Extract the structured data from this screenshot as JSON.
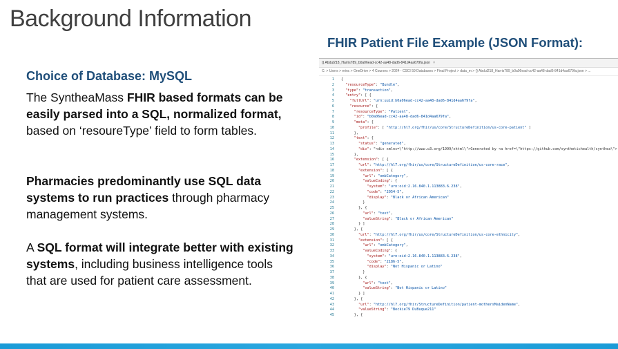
{
  "slide": {
    "title": "Background Information"
  },
  "left": {
    "subheading": "Choice of Database:  MySQL",
    "p1": {
      "a": "The SyntheaMass ",
      "b": "FHIR based formats can be easily parsed into a SQL, normalized format,",
      "c": " based on ‘resoureType’ field to form tables."
    },
    "p2": {
      "a": "Pharmacies predominantly use SQL data systems to run practices",
      "b": " through pharmacy management systems."
    },
    "p3": {
      "a": "A ",
      "b": "SQL format will integrate better with existing systems",
      "c": ", including business intelligence tools that are used for patient care assessment."
    }
  },
  "right": {
    "caption": "FHIR Patient File Example (JSON Format):",
    "tab_label": "{} Abdul218_Harris789_b0a06ead-cc42-aa48-dad6-841d4aa679fa.json",
    "tab_close": "×",
    "breadcrumb": "C: > Users > erinc > OneDrive > 4 Courses > 2024 - CSCI 59 Databases > Final Project > data_m > {} Abdul218_Harris789_b0a06ead-cc42-aa48-dad6-841d4aa679fa.json > ...",
    "code": [
      {
        "n": "1",
        "t": "{"
      },
      {
        "n": "2",
        "t": "  \"resourceType\": \"Bundle\","
      },
      {
        "n": "3",
        "t": "  \"type\": \"transaction\","
      },
      {
        "n": "4",
        "t": "  \"entry\": [ {"
      },
      {
        "n": "5",
        "t": "    \"fullUrl\": \"urn:uuid:b0a06ead-cc42-aa48-dad6-841d4aa679fa\","
      },
      {
        "n": "6",
        "t": "    \"resource\": {"
      },
      {
        "n": "7",
        "t": "      \"resourceType\": \"Patient\","
      },
      {
        "n": "8",
        "t": "      \"id\": \"b0a06ead-cc42-aa48-dad6-841d4aa679fa\","
      },
      {
        "n": "9",
        "t": "      \"meta\": {"
      },
      {
        "n": "10",
        "t": "        \"profile\": [ \"http://hl7.org/fhir/us/core/StructureDefinition/us-core-patient\" ]"
      },
      {
        "n": "11",
        "t": "      },"
      },
      {
        "n": "12",
        "t": "      \"text\": {"
      },
      {
        "n": "13",
        "t": "        \"status\": \"generated\","
      },
      {
        "n": "14",
        "t": "        \"div\": \"<div xmlns=\\\"http://www.w3.org/1999/xhtml\\\">Generated by <a href=\\\"https://github.com/synthetichealth/synthea\\\">"
      },
      {
        "n": "15",
        "t": "      },"
      },
      {
        "n": "16",
        "t": "      \"extension\": [ {"
      },
      {
        "n": "17",
        "t": "        \"url\": \"http://hl7.org/fhir/us/core/StructureDefinition/us-core-race\","
      },
      {
        "n": "18",
        "t": "        \"extension\": [ {"
      },
      {
        "n": "19",
        "t": "          \"url\": \"ombCategory\","
      },
      {
        "n": "20",
        "t": "          \"valueCoding\": {"
      },
      {
        "n": "21",
        "t": "            \"system\": \"urn:oid:2.16.840.1.113883.6.238\","
      },
      {
        "n": "22",
        "t": "            \"code\": \"2054-5\","
      },
      {
        "n": "23",
        "t": "            \"display\": \"Black or African American\""
      },
      {
        "n": "24",
        "t": "          }"
      },
      {
        "n": "25",
        "t": "        }, {"
      },
      {
        "n": "26",
        "t": "          \"url\": \"text\","
      },
      {
        "n": "27",
        "t": "          \"valueString\": \"Black or African American\""
      },
      {
        "n": "28",
        "t": "        } ]"
      },
      {
        "n": "29",
        "t": "      }, {"
      },
      {
        "n": "30",
        "t": "        \"url\": \"http://hl7.org/fhir/us/core/StructureDefinition/us-core-ethnicity\","
      },
      {
        "n": "31",
        "t": "        \"extension\": [ {"
      },
      {
        "n": "32",
        "t": "          \"url\": \"ombCategory\","
      },
      {
        "n": "33",
        "t": "          \"valueCoding\": {"
      },
      {
        "n": "34",
        "t": "            \"system\": \"urn:oid:2.16.840.1.113883.6.238\","
      },
      {
        "n": "35",
        "t": "            \"code\": \"2186-5\","
      },
      {
        "n": "36",
        "t": "            \"display\": \"Not Hispanic or Latino\""
      },
      {
        "n": "37",
        "t": "          }"
      },
      {
        "n": "38",
        "t": "        }, {"
      },
      {
        "n": "39",
        "t": "          \"url\": \"text\","
      },
      {
        "n": "40",
        "t": "          \"valueString\": \"Not Hispanic or Latino\""
      },
      {
        "n": "41",
        "t": "        } ]"
      },
      {
        "n": "42",
        "t": "      }, {"
      },
      {
        "n": "43",
        "t": "        \"url\": \"http://hl7.org/fhir/StructureDefinition/patient-mothersMaidenName\","
      },
      {
        "n": "44",
        "t": "        \"valueString\": \"Beckie79 DuBuque211\""
      },
      {
        "n": "45",
        "t": "      }, {"
      }
    ]
  },
  "colors": {
    "title": "#404040",
    "heading_blue": "#1f4e79",
    "footer_bar": "#1a9bd7"
  }
}
